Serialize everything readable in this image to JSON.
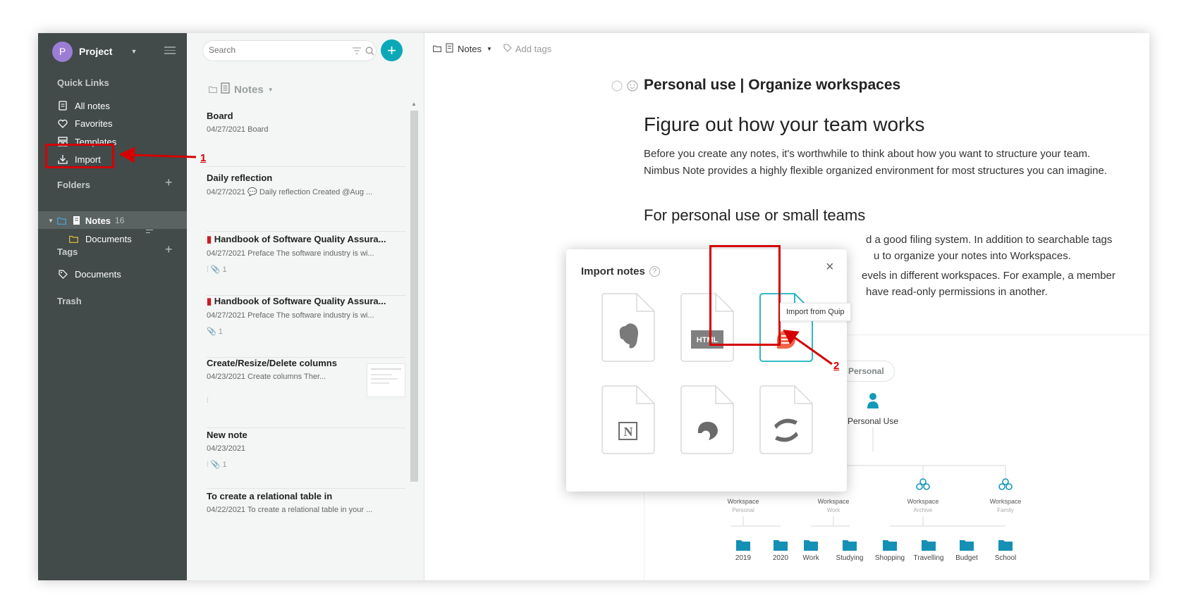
{
  "sidebar": {
    "project": {
      "avatar": "P",
      "name": "Project"
    },
    "quick_links_heading": "Quick Links",
    "quick_links": [
      {
        "label": "All notes",
        "icon": "all-notes-icon"
      },
      {
        "label": "Favorites",
        "icon": "heart-icon"
      },
      {
        "label": "Templates",
        "icon": "templates-icon"
      },
      {
        "label": "Import",
        "icon": "import-icon"
      }
    ],
    "folders_heading": "Folders",
    "folders": [
      {
        "label": "Notes",
        "count": "16"
      },
      {
        "label": "Documents"
      }
    ],
    "tags_heading": "Tags",
    "tags": [
      {
        "label": "Documents"
      }
    ],
    "trash_label": "Trash"
  },
  "list": {
    "search_placeholder": "Search",
    "heading": "Notes",
    "notes": [
      {
        "title": "Board",
        "meta": "04/27/2021 Board",
        "extra": ""
      },
      {
        "title": "Daily reflection",
        "meta": "04/27/2021 💬 Daily reflection Created @Aug ...",
        "extra": ""
      },
      {
        "title": "Handbook of Software Quality Assura...",
        "meta": "04/27/2021 Preface The software industry is wi...",
        "extra": "⫶ 📎 1"
      },
      {
        "title": "Handbook of Software Quality Assura...",
        "meta": "04/27/2021 Preface The software industry is wi...",
        "extra": "📎 1"
      },
      {
        "title": "Create/Resize/Delete columns",
        "meta": "04/23/2021 Create columns Ther...",
        "extra": "⫶"
      },
      {
        "title": "New note",
        "meta": "04/23/2021",
        "extra": "⫶ 📎 1"
      },
      {
        "title": "To create a relational table in",
        "meta": "04/22/2021 To create a relational table in your ...",
        "extra": ""
      }
    ]
  },
  "content": {
    "breadcrumb_folder": "Notes",
    "add_tags": "Add tags",
    "title": "Personal use | Organize workspaces",
    "h1": "Figure out how your team works",
    "p1": "Before you create any notes, it's worthwhile to think about how you want to structure your team. Nimbus Note provides a highly flexible organized environment for most structures you can imagine.",
    "h2": "For personal use or small teams",
    "p2": "d a good filing system. In addition to searchable tags",
    "p3": "u to organize your notes into Workspaces.",
    "p4": "evels in different workspaces. For example, a member",
    "p5": "have read-only permissions in another.",
    "diagram": {
      "pill": "Personal",
      "root": "Personal Use",
      "workspaces": [
        {
          "label": "Workspace",
          "sub": "Personal"
        },
        {
          "label": "Workspace",
          "sub": "Work"
        },
        {
          "label": "Workspace",
          "sub": "Archive"
        },
        {
          "label": "Workspace",
          "sub": "Family"
        }
      ],
      "folders": [
        "2019",
        "2020",
        "Work",
        "Studying",
        "Shopping",
        "Travelling",
        "Budget",
        "School"
      ]
    }
  },
  "modal": {
    "title": "Import notes",
    "help": "?",
    "close": "×",
    "options": [
      {
        "name": "evernote",
        "text": ""
      },
      {
        "name": "html",
        "text": "HTML"
      },
      {
        "name": "quip",
        "text": ""
      },
      {
        "name": "notion",
        "text": "N"
      },
      {
        "name": "bear",
        "text": ""
      },
      {
        "name": "confluence",
        "text": ""
      }
    ],
    "tooltip": "Import from Quip"
  },
  "annotations": {
    "step1": "1",
    "step2": "2"
  },
  "colors": {
    "accent": "#0ba9b8",
    "sidebar": "#424a4a",
    "highlight": "#d40000",
    "quip": "#f0644b"
  }
}
